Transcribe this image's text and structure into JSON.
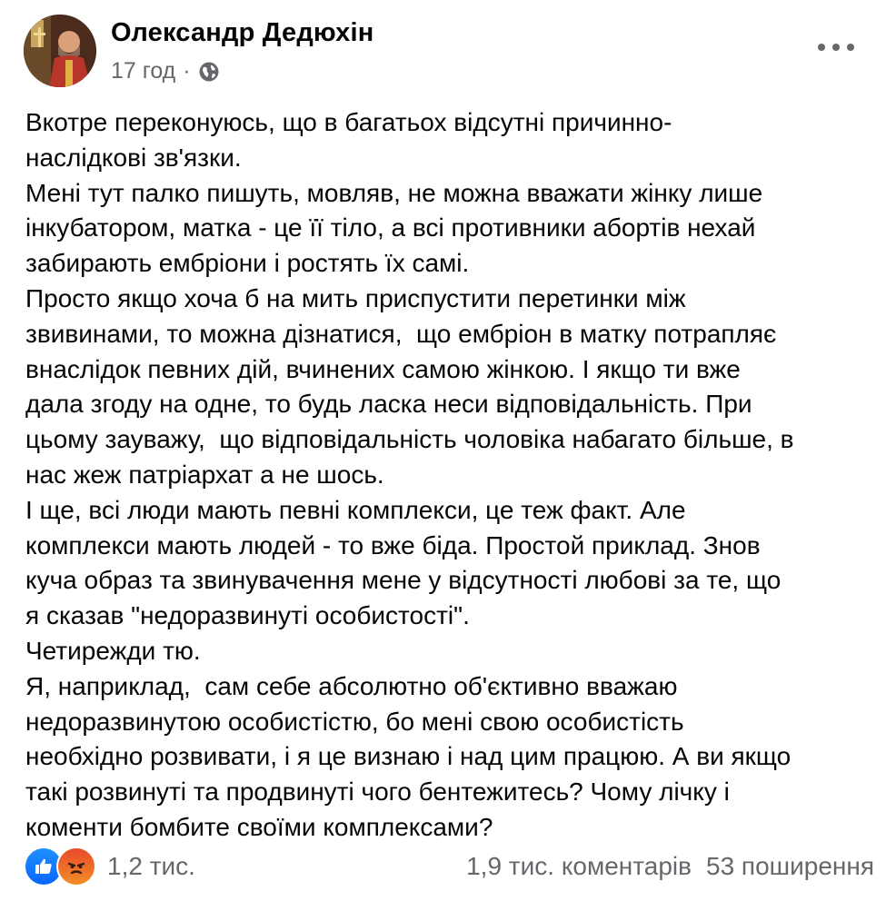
{
  "post": {
    "author": "Олександр Дедюхін",
    "time": "17 год",
    "separator": "·",
    "privacy_icon": "globe-icon",
    "menu_icon": "more-horizontal-icon",
    "paragraphs": [
      "Вкотре переконуюсь, що в багатьох відсутні причинно-\nнаслідкові зв'язки.",
      "Мені тут палко пишуть, мовляв, не можна вважати жінку лише\nінкубатором, матка - це її тіло, а всі противники абортів нехай\nзабирають ембріони і ростять їх самі.",
      "Просто якщо хоча б на мить приспустити перетинки між\nзвивинами, то можна дізнатися,  що ембріон в матку потрапляє\nвнаслідок певних дій, вчинених самою жінкою. І якщо ти вже\nдала згоду на одне, то будь ласка неси відповідальність. При\nцьому зауважу,  що відповідальність чоловіка набагато більше, в\nнас жеж патріархат а не шось.",
      "І ще, всі люди мають певні комплекси, це теж факт. Але\nкомплекси мають людей - то вже біда. Простой приклад. Знов\nкуча образ та звинувачення мене у відсутності любові за те, що\nя сказав \"недоразвинуті особистості\".",
      "Четирежди тю.",
      "Я, наприклад,  сам себе абсолютно об'єктивно вважаю\nнедоразвинутою особистістю, бо мені свою особистість\nнеобхідно розвивати, і я це визнаю і над цим працюю. А ви якщо\nтакі розвинуті та продвинуті чого бентежитесь? Чому лічку і\nкоменти бомбите своїми комплексами?"
    ],
    "reactions": {
      "icons": [
        "like-icon",
        "angry-icon"
      ],
      "count": "1,2 тис."
    },
    "comments": "1,9 тис. коментарів",
    "shares": "53 поширення"
  },
  "colors": {
    "text": "#050505",
    "secondary": "#65676b",
    "like": "#0866ff",
    "angry": "#e94a2b"
  }
}
